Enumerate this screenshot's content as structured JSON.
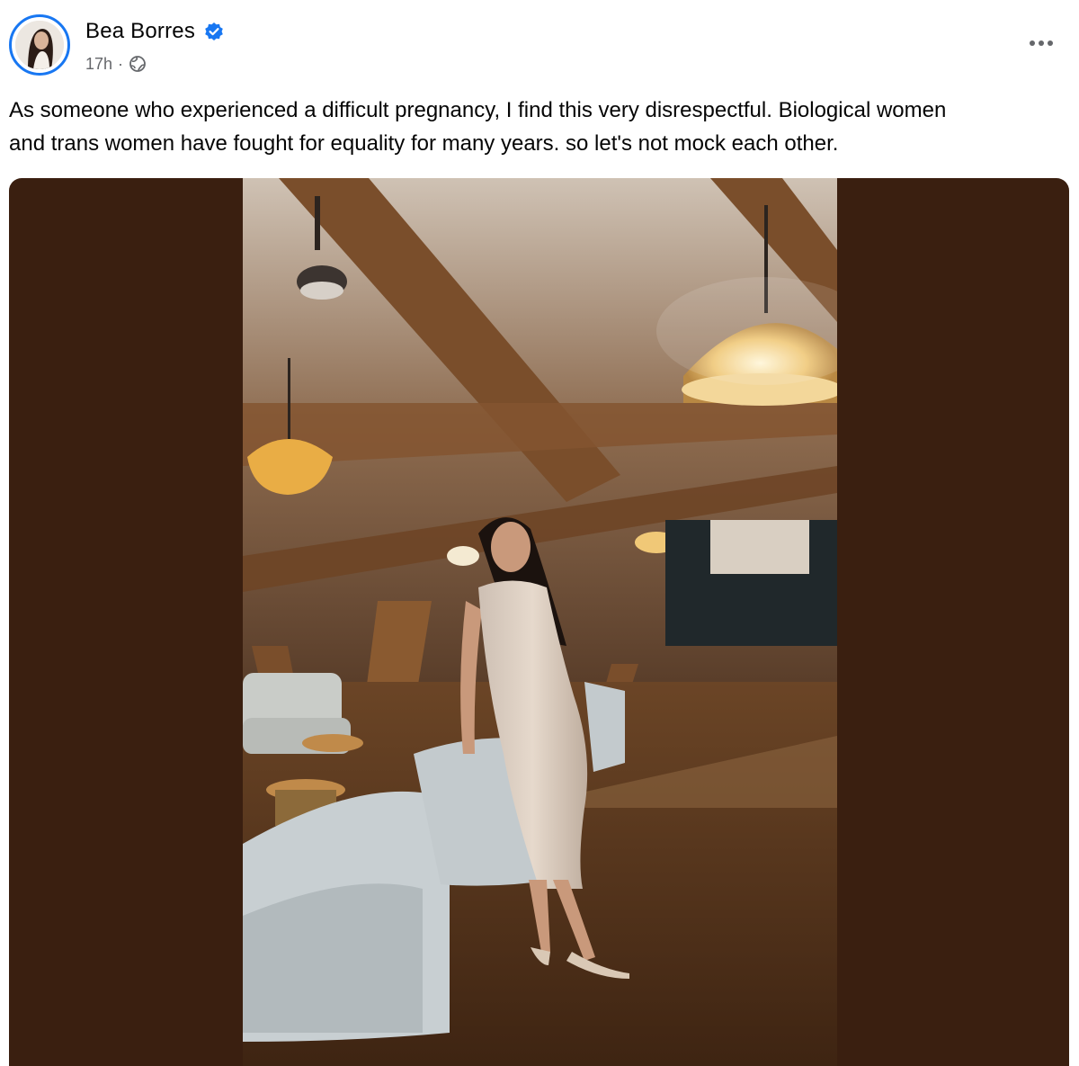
{
  "post": {
    "author": "Bea Borres",
    "timestamp": "17h",
    "separator": "·",
    "audience_icon": "globe-icon",
    "verified_icon": "verified-badge-icon",
    "more_icon": "more-options-icon",
    "caption": "As someone who experienced a difficult pregnancy, I find this very disrespectful. Biological women\nand trans women have fought for equality for many years. so let's not mock each other."
  },
  "colors": {
    "verified": "#1877f2",
    "meta_text": "#65676b",
    "media_background": "#3a1f10"
  }
}
